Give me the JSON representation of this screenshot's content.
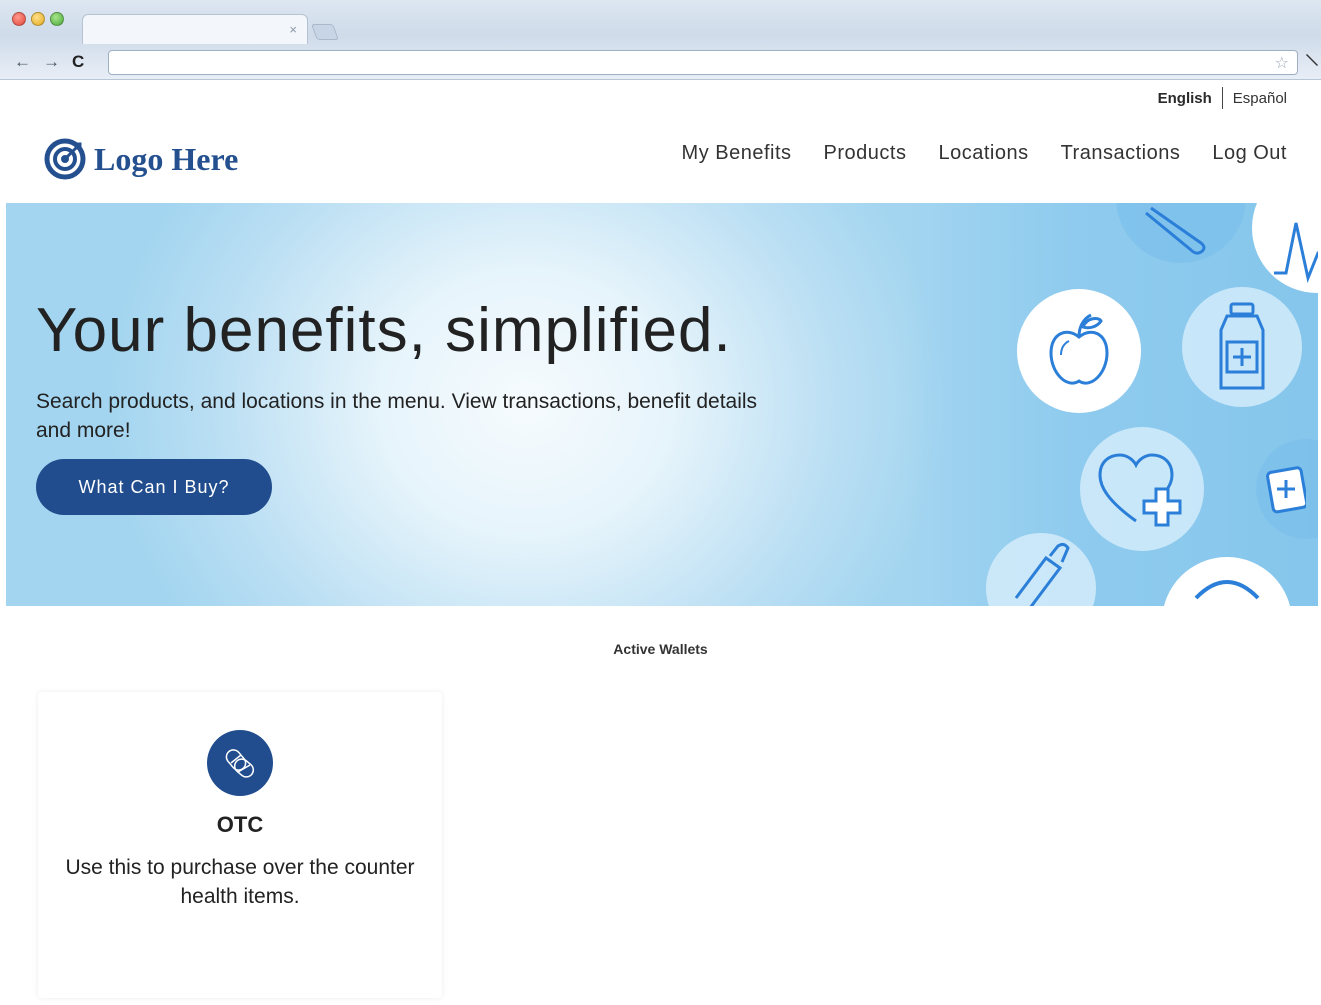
{
  "browser": {
    "tab_close": "×",
    "back": "←",
    "forward": "→",
    "reload": "C",
    "star": "☆",
    "menu": "🔧"
  },
  "language": {
    "english": "English",
    "spanish": "Español"
  },
  "header": {
    "logo_text": "Logo Here",
    "nav": [
      "My Benefits",
      "Products",
      "Locations",
      "Transactions",
      "Log Out"
    ]
  },
  "hero": {
    "title": "Your benefits, simplified.",
    "subtitle": "Search products, and locations in the menu. View transactions, benefit details and more!",
    "cta_label": "What Can I Buy?"
  },
  "wallets": {
    "section_title": "Active Wallets",
    "items": [
      {
        "title": "OTC",
        "description": "Use this to purchase over the counter health items.",
        "icon": "pills-icon"
      }
    ]
  },
  "colors": {
    "brand": "#214d8e",
    "hero_blue": "#8fcbee",
    "icon_blue": "#2b7fd8"
  }
}
